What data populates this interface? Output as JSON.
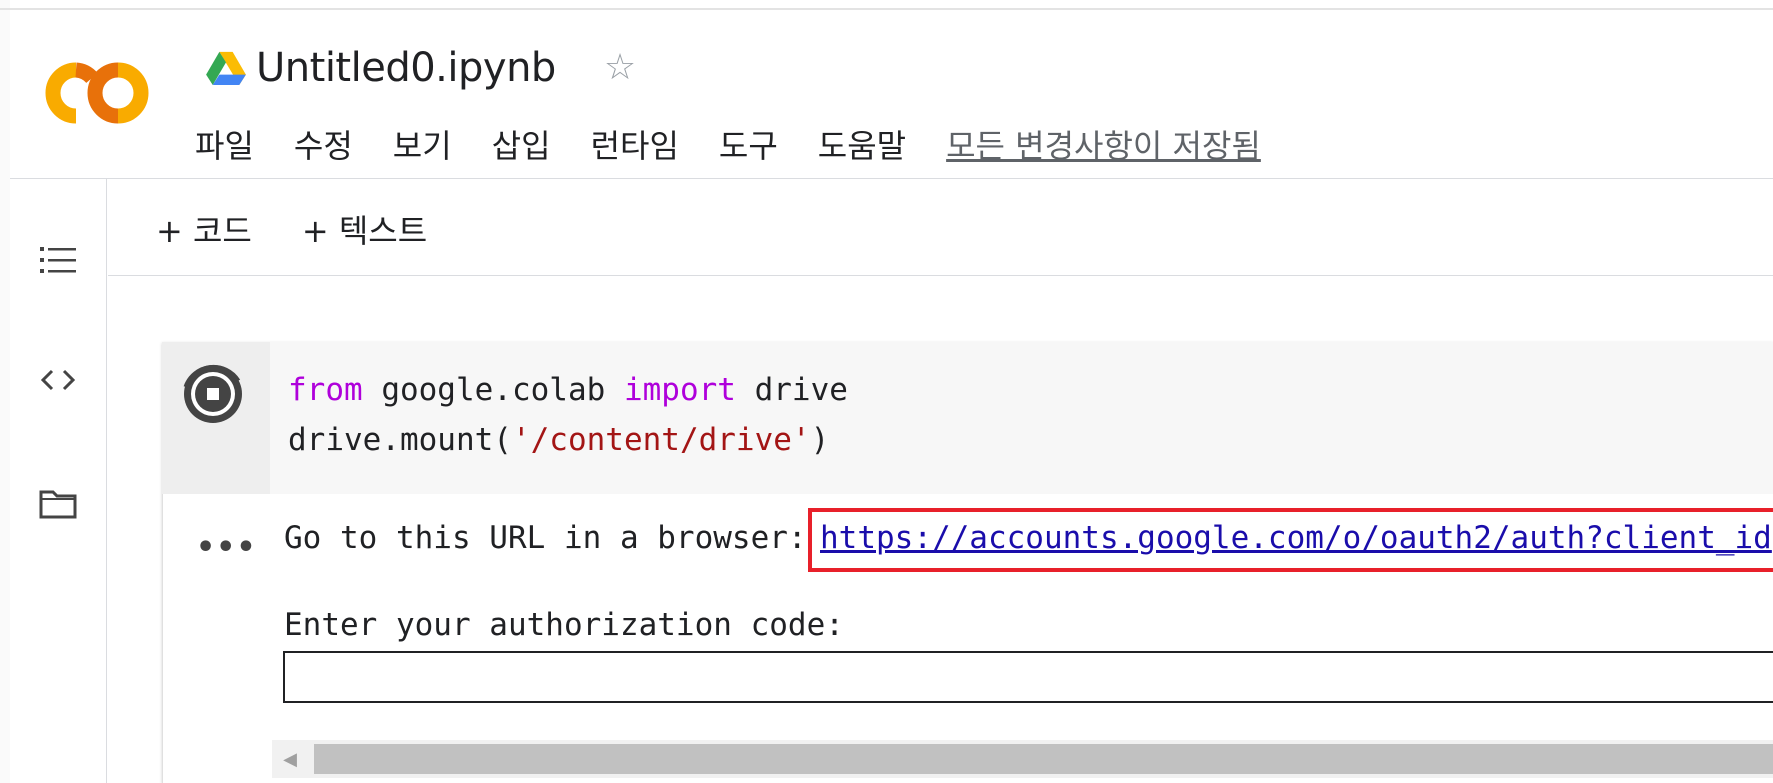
{
  "header": {
    "title": "Untitled0.ipynb",
    "menu": [
      {
        "label": "파일"
      },
      {
        "label": "수정"
      },
      {
        "label": "보기"
      },
      {
        "label": "삽입"
      },
      {
        "label": "런타임"
      },
      {
        "label": "도구"
      },
      {
        "label": "도움말"
      }
    ],
    "save_status": "모든 변경사항이 저장됨"
  },
  "toolbar": {
    "add_code": "+ 코드",
    "add_text": "+ 텍스트"
  },
  "sidebar": {
    "icons": [
      "toc-icon",
      "code-snippets-icon",
      "folder-icon"
    ]
  },
  "cell": {
    "code": {
      "line1": {
        "kw1": "from",
        "mod": " google.colab ",
        "kw2": "import",
        "name": " drive"
      },
      "line2": {
        "pre": "drive.mount(",
        "str": "'/content/drive'",
        "post": ")"
      }
    },
    "output": {
      "ellipsis": "•••",
      "prompt": "Go to this URL in a browser: ",
      "url": "https://accounts.google.com/o/oauth2/auth?client_id",
      "auth_label": "Enter your authorization code:",
      "auth_value": ""
    }
  },
  "colors": {
    "brand": "#f9ab00",
    "highlight_box": "#e8202a",
    "keyword": "#af00db",
    "string": "#a31515",
    "link": "#1a0dab"
  }
}
